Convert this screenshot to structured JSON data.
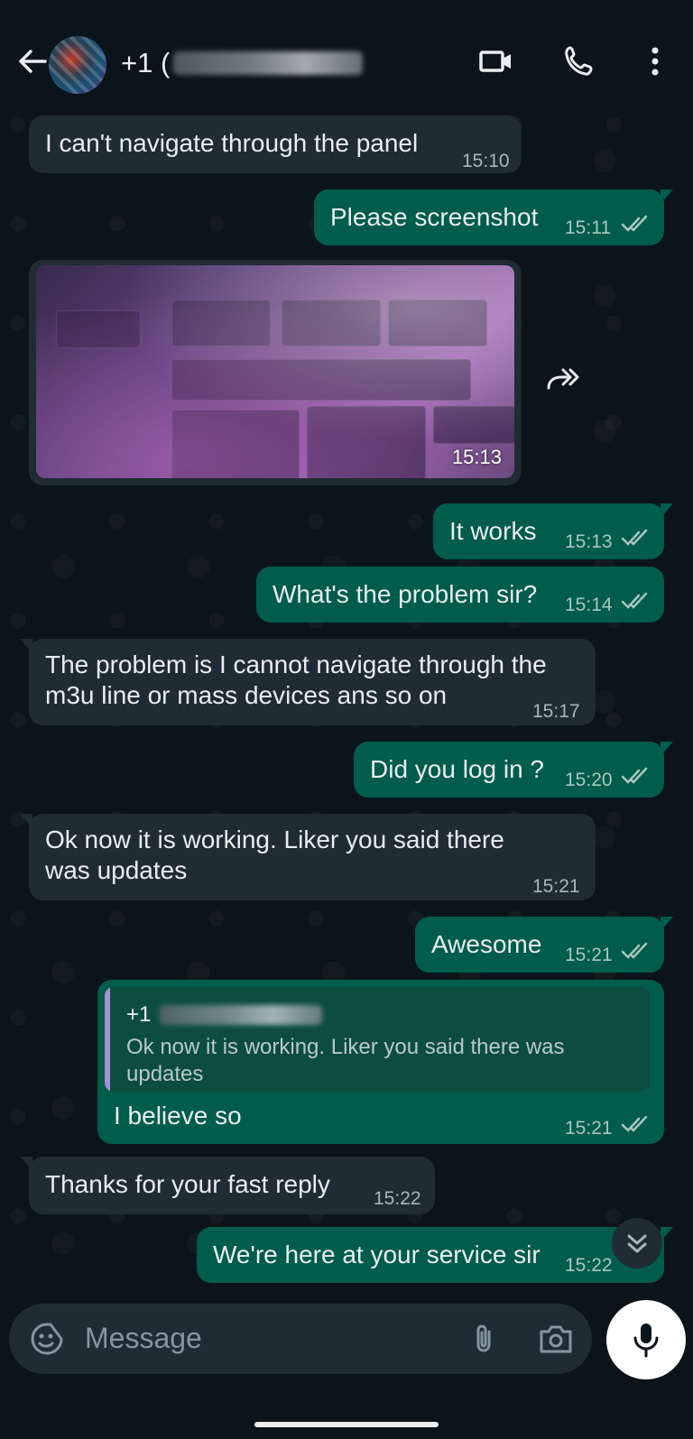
{
  "header": {
    "title_prefix": "+1 (",
    "back_icon": "arrow-left-icon",
    "video_icon": "video-camera-icon",
    "call_icon": "phone-icon",
    "menu_icon": "more-vertical-icon"
  },
  "messages": [
    {
      "dir": "in",
      "text": "I can't navigate through the panel",
      "time": "15:10"
    },
    {
      "dir": "out",
      "text": "Please screenshot",
      "time": "15:11",
      "read": true
    },
    {
      "dir": "in",
      "type": "image",
      "time": "15:13"
    },
    {
      "dir": "out",
      "text": "It works",
      "time": "15:13",
      "read": true
    },
    {
      "dir": "out",
      "text": "What's the problem sir?",
      "time": "15:14",
      "read": true
    },
    {
      "dir": "in",
      "text_line1": "The problem is I cannot navigate through the",
      "text_line2": "m3u line or mass devices ans so on",
      "time": "15:17"
    },
    {
      "dir": "out",
      "text": "Did you log in ?",
      "time": "15:20",
      "read": true
    },
    {
      "dir": "in",
      "text_line1": "Ok now it is working. Liker you said there",
      "text_line2": "was updates",
      "time": "15:21"
    },
    {
      "dir": "out",
      "text": "Awesome",
      "time": "15:21",
      "read": true
    },
    {
      "dir": "out",
      "type": "reply",
      "quote_name_prefix": "+1",
      "quote_line1": "Ok now it is working. Liker you said there was",
      "quote_line2": "updates",
      "text": "I believe so",
      "time": "15:21",
      "read": true
    },
    {
      "dir": "in",
      "text": "Thanks for your fast reply",
      "time": "15:22"
    },
    {
      "dir": "out",
      "text": "We're here at your service sir",
      "time": "15:22",
      "read": true
    }
  ],
  "composer": {
    "placeholder": "Message",
    "emoji_icon": "emoji-sticker-icon",
    "attach_icon": "paperclip-icon",
    "camera_icon": "camera-icon",
    "mic_icon": "microphone-icon"
  },
  "colors": {
    "background": "#0b141a",
    "incoming_bubble": "#202c33",
    "outgoing_bubble": "#005c4b",
    "read_ticks": "#a9c7bf",
    "quote_bar": "#a390d7"
  }
}
